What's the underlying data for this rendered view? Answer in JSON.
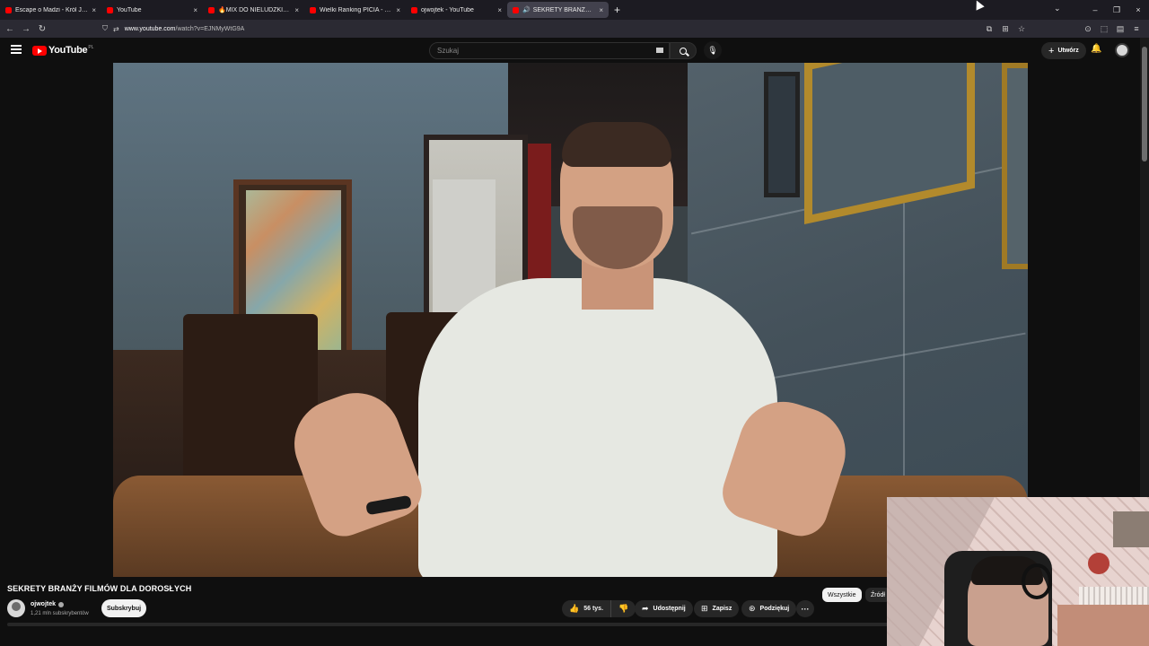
{
  "browser": {
    "tabs": [
      {
        "label": "Escape o Madzi - Król Julian & ",
        "active": false
      },
      {
        "label": "YouTube",
        "active": false
      },
      {
        "label": "🔥MIX DO NIELUDZKIEJ PRACY",
        "active": false
      },
      {
        "label": "Wielki Ranking PICIA - CZEGO ",
        "active": false
      },
      {
        "label": "ojwojtek - YouTube",
        "active": false
      },
      {
        "label": "SEKRETY BRANŻY FILMÓW",
        "active": true
      }
    ],
    "new_tab": "+",
    "close_glyph": "×",
    "tab_list_glyph": "⌄",
    "window_controls": {
      "minimize": "–",
      "restore": "❐",
      "close": "×"
    },
    "url_host": "www.youtube.com",
    "url_path": "/watch?v=EJNMyWtG9A",
    "nav": {
      "back": "←",
      "forward": "→",
      "reload": "↻"
    },
    "nav_right_icons": [
      "⧉",
      "⊞",
      "☆",
      "⊙",
      "⬚",
      "▤",
      "≡"
    ]
  },
  "youtube": {
    "logo_text": "YouTube",
    "region": "PL",
    "search_placeholder": "Szukaj",
    "mic_glyph": "🎙",
    "create_label": "Utwórz",
    "create_glyph": "+",
    "bell_glyph": "🔔"
  },
  "video": {
    "title": "SEKRETY BRANŻY FILMÓW DLA DOROSŁYCH",
    "channel": "ojwojtek",
    "subscribers": "1,21 mln subskrybentów",
    "subscribe_label": "Subskrybuj",
    "likes": "56 tys.",
    "like_glyph": "👍",
    "dislike_glyph": "👎",
    "share_label": "Udostępnij",
    "share_glyph": "➦",
    "save_label": "Zapisz",
    "save_glyph": "⊞",
    "thanks_label": "Podziękuj",
    "thanks_glyph": "⊛",
    "more_glyph": "···"
  },
  "chips": {
    "selected": "Wszystkie",
    "next": "Źródł"
  },
  "colors": {
    "youtube_red": "#ff0000",
    "background": "#0f0f0f",
    "pill": "#272727"
  }
}
